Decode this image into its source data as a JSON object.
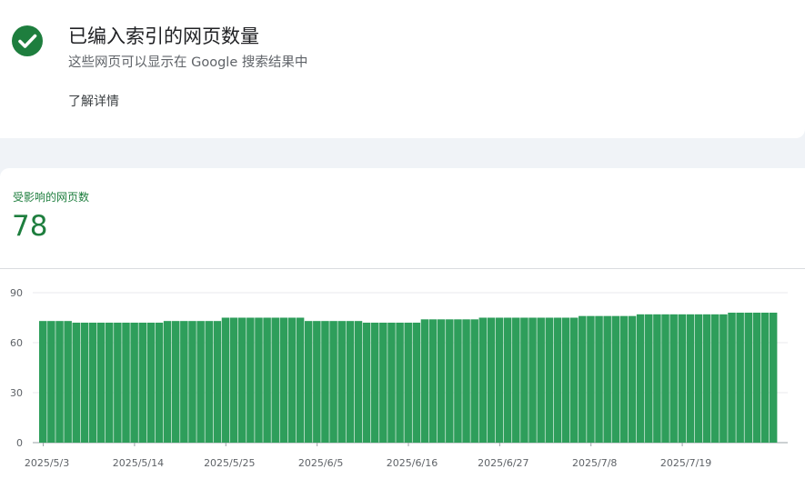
{
  "header": {
    "title": "已编入索引的网页数量",
    "subtitle": "这些网页可以显示在 Google 搜索结果中",
    "learn_more": "了解详情",
    "status_icon": "check-circle-icon",
    "accent_color": "#1e7e3e"
  },
  "metric": {
    "label": "受影响的网页数",
    "value": "78"
  },
  "chart_data": {
    "type": "bar",
    "color": "#2e9e5b",
    "ylim": [
      0,
      90
    ],
    "yticks": [
      0,
      30,
      60,
      90
    ],
    "grid": true,
    "xticks": [
      "2025/5/3",
      "2025/5/14",
      "2025/5/25",
      "2025/6/5",
      "2025/6/16",
      "2025/6/27",
      "2025/7/8",
      "2025/7/19"
    ],
    "values": [
      73,
      73,
      73,
      73,
      72,
      72,
      72,
      72,
      72,
      72,
      72,
      72,
      72,
      72,
      72,
      73,
      73,
      73,
      73,
      73,
      73,
      73,
      75,
      75,
      75,
      75,
      75,
      75,
      75,
      75,
      75,
      75,
      73,
      73,
      73,
      73,
      73,
      73,
      73,
      72,
      72,
      72,
      72,
      72,
      72,
      72,
      74,
      74,
      74,
      74,
      74,
      74,
      74,
      75,
      75,
      75,
      75,
      75,
      75,
      75,
      75,
      75,
      75,
      75,
      75,
      76,
      76,
      76,
      76,
      76,
      76,
      76,
      77,
      77,
      77,
      77,
      77,
      77,
      77,
      77,
      77,
      77,
      77,
      78,
      78,
      78,
      78,
      78,
      78
    ]
  }
}
